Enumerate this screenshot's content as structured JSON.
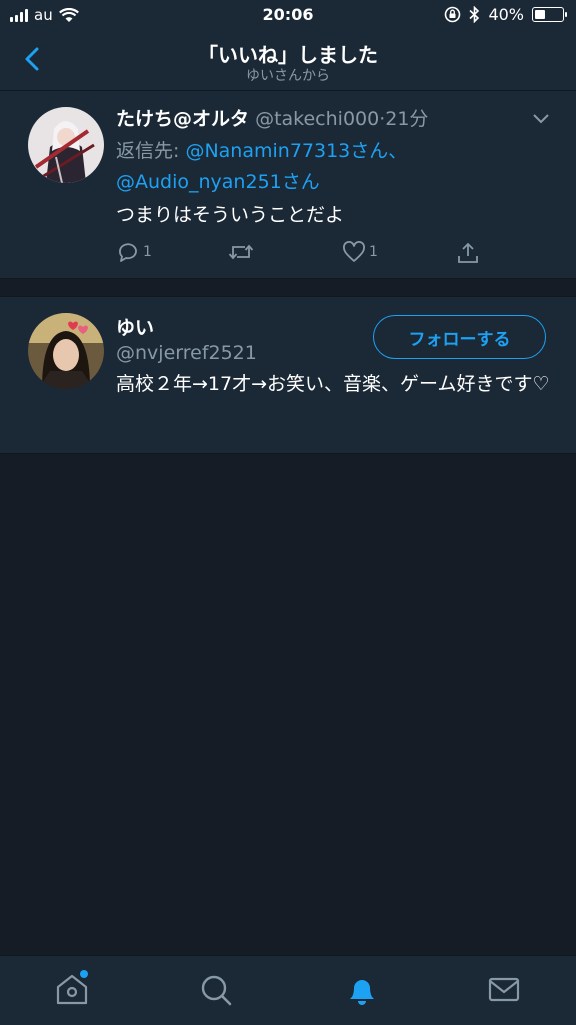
{
  "status_bar": {
    "carrier": "au",
    "time": "20:06",
    "battery": "40%",
    "battery_level": 0.4
  },
  "nav": {
    "title": "「いいね」しました",
    "subtitle": "ゆいさんから"
  },
  "tweet": {
    "name": "たけち@オルタ",
    "handle": "@takechi000",
    "separator": "·",
    "time": "21分",
    "reply_prefix": "返信先: ",
    "reply_to_1": "@Nanamin77313さん、",
    "reply_to_2": "@Audio_nyan251さん",
    "text": "つまりはそういうことだよ",
    "reply_count": "1",
    "like_count": "1"
  },
  "user": {
    "name": "ゆい",
    "handle": "@nvjerref2521",
    "bio": "高校２年→17才→お笑い、音楽、ゲーム好きです♡",
    "follow_label": "フォローする"
  },
  "colors": {
    "accent": "#1da1f2",
    "background": "#151c26",
    "card": "#1b2836",
    "muted": "#8899a6"
  },
  "tabs": [
    "home-icon",
    "search-icon",
    "notifications-icon",
    "messages-icon"
  ]
}
